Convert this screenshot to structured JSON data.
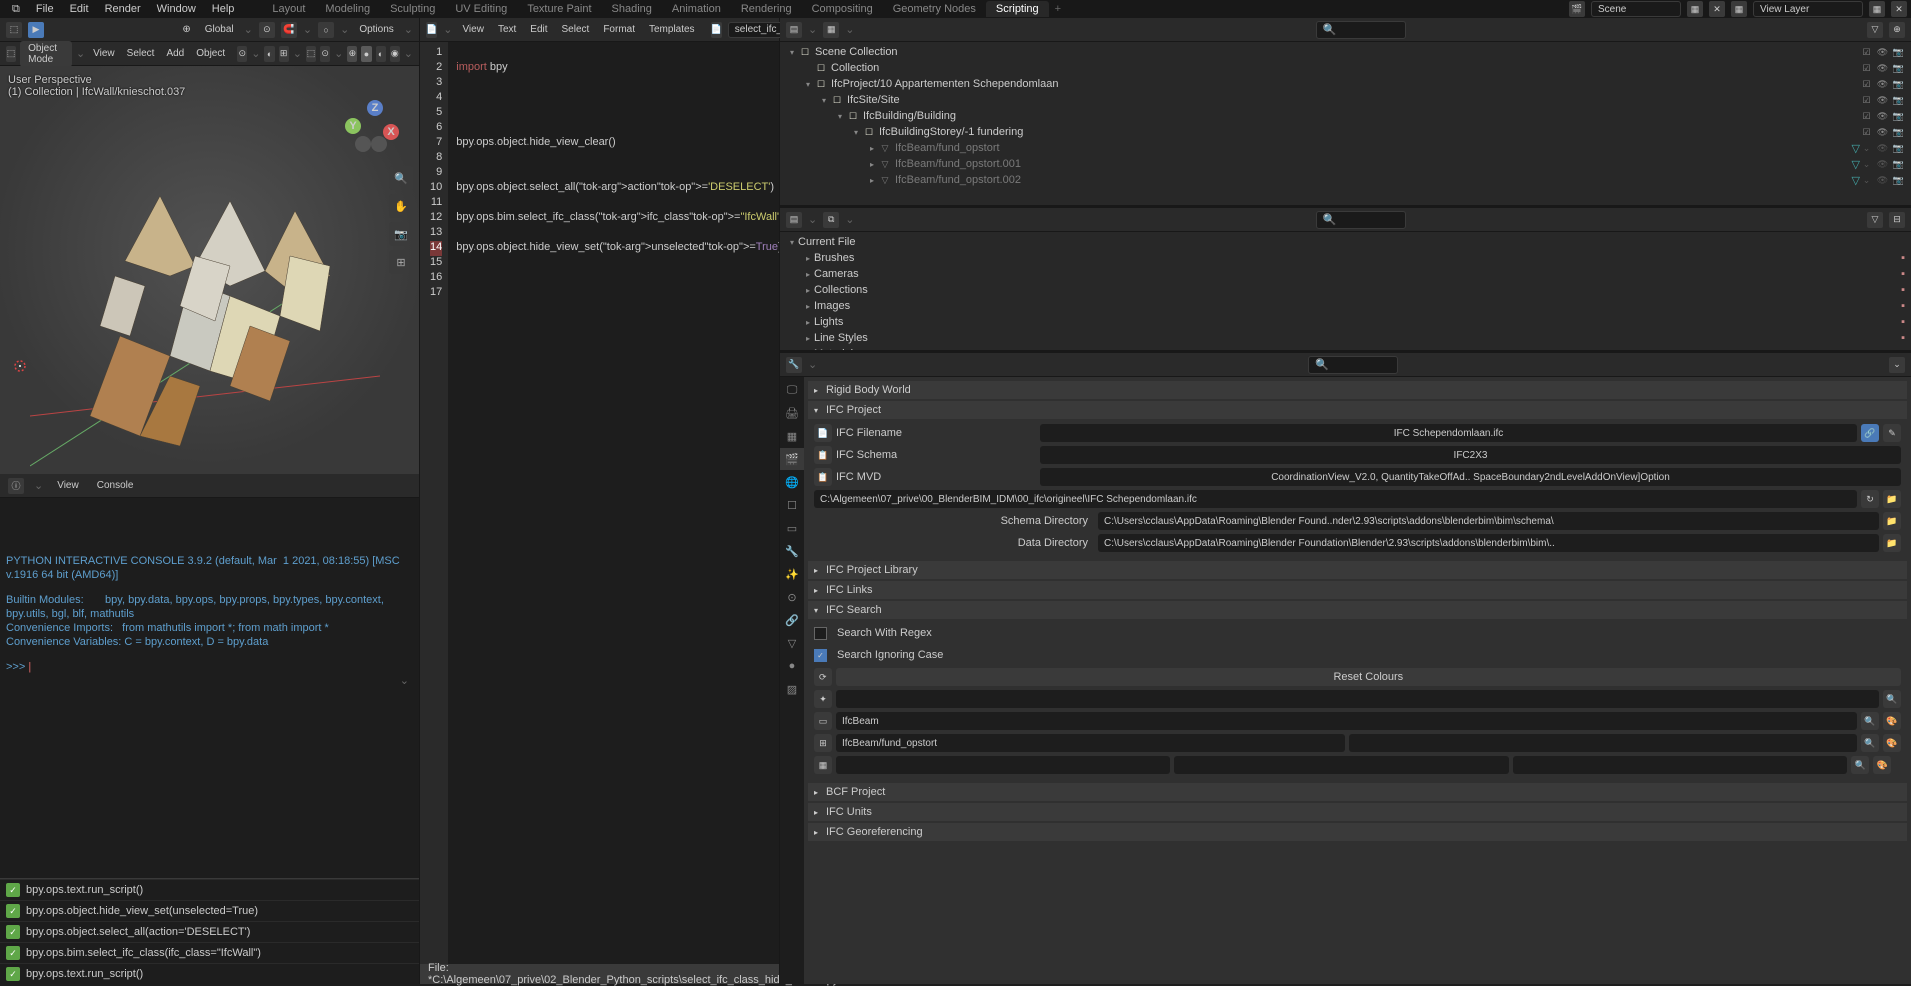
{
  "menu": {
    "logo": "⧉",
    "items": [
      "File",
      "Edit",
      "Render",
      "Window",
      "Help"
    ]
  },
  "workspaces": [
    "Layout",
    "Modeling",
    "Sculpting",
    "UV Editing",
    "Texture Paint",
    "Shading",
    "Animation",
    "Rendering",
    "Compositing",
    "Geometry Nodes",
    "Scripting"
  ],
  "active_workspace": "Scripting",
  "scene_selector": {
    "scene": "Scene",
    "layer": "View Layer"
  },
  "viewport": {
    "mode": "Object Mode",
    "menus": [
      "View",
      "Select",
      "Add",
      "Object"
    ],
    "orient": "Global",
    "info_line1": "User Perspective",
    "info_line2": "(1) Collection | IfcWall/knieschot.037",
    "axes": {
      "x": "X",
      "y": "Y",
      "z": "Z"
    },
    "options": "Options"
  },
  "text_editor": {
    "menus": [
      "View",
      "Text",
      "Edit",
      "Select",
      "Format",
      "Templates"
    ],
    "filename": "select_ifc_clas",
    "lines": [
      {
        "n": 1,
        "raw": ""
      },
      {
        "n": 2,
        "raw": "import bpy",
        "k": "import",
        "rest": " bpy"
      },
      {
        "n": 3,
        "raw": ""
      },
      {
        "n": 4,
        "raw": ""
      },
      {
        "n": 5,
        "raw": ""
      },
      {
        "n": 6,
        "raw": ""
      },
      {
        "n": 7,
        "raw": "bpy.ops.object.hide_view_clear()"
      },
      {
        "n": 8,
        "raw": ""
      },
      {
        "n": 9,
        "raw": ""
      },
      {
        "n": 10,
        "raw": "bpy.ops.object.select_all(action='DESELECT')"
      },
      {
        "n": 11,
        "raw": ""
      },
      {
        "n": 12,
        "raw": "bpy.ops.bim.select_ifc_class(ifc_class=\"IfcWall\")"
      },
      {
        "n": 13,
        "raw": ""
      },
      {
        "n": 14,
        "raw": "bpy.ops.object.hide_view_set(unselected=True)"
      },
      {
        "n": 15,
        "raw": ""
      },
      {
        "n": 16,
        "raw": ""
      },
      {
        "n": 17,
        "raw": ""
      }
    ],
    "current_line": 14,
    "footer": "File: *C:\\Algemeen\\07_prive\\02_Blender_Python_scripts\\select_ifc_class_hide_isolate.py"
  },
  "info_panel": {
    "menus": [
      "View",
      "Console"
    ]
  },
  "console": {
    "header": "PYTHON INTERACTIVE CONSOLE 3.9.2 (default, Mar  1 2021, 08:18:55) [MSC v.1916 64 bit (AMD64)]",
    "builtin": "Builtin Modules:       bpy, bpy.data, bpy.ops, bpy.props, bpy.types, bpy.context, bpy.utils, bgl, blf, mathutils",
    "imports": "Convenience Imports:   from mathutils import *; from math import *",
    "vars": "Convenience Variables: C = bpy.context, D = bpy.data",
    "prompt": ">>> ",
    "cursor": "|"
  },
  "reports": [
    "bpy.ops.text.run_script()",
    "bpy.ops.object.hide_view_set(unselected=True)",
    "bpy.ops.object.select_all(action='DESELECT')",
    "bpy.ops.bim.select_ifc_class(ifc_class=\"IfcWall\")",
    "bpy.ops.text.run_script()"
  ],
  "outliner": {
    "root": "Scene Collection",
    "tree": [
      {
        "depth": 0,
        "tw": "▾",
        "ic": "☐",
        "txt": "Scene Collection",
        "dim": false,
        "ricons": true
      },
      {
        "depth": 1,
        "tw": "",
        "ic": "☐",
        "txt": "Collection",
        "dim": false,
        "ricons": true
      },
      {
        "depth": 1,
        "tw": "▾",
        "ic": "☐",
        "txt": "IfcProject/10 Appartementen Schependomlaan",
        "dim": false,
        "ricons": true
      },
      {
        "depth": 2,
        "tw": "▾",
        "ic": "☐",
        "txt": "IfcSite/Site",
        "dim": false,
        "ricons": true
      },
      {
        "depth": 3,
        "tw": "▾",
        "ic": "☐",
        "txt": "IfcBuilding/Building",
        "dim": false,
        "ricons": true
      },
      {
        "depth": 4,
        "tw": "▾",
        "ic": "☐",
        "txt": "IfcBuildingStorey/-1 fundering",
        "dim": false,
        "ricons": true
      },
      {
        "depth": 5,
        "tw": "▸",
        "ic": "▽",
        "txt": "IfcBeam/fund_opstort",
        "dim": true,
        "ricons": false,
        "extra": "▽"
      },
      {
        "depth": 5,
        "tw": "▸",
        "ic": "▽",
        "txt": "IfcBeam/fund_opstort.001",
        "dim": true,
        "ricons": false,
        "extra": "▽"
      },
      {
        "depth": 5,
        "tw": "▸",
        "ic": "▽",
        "txt": "IfcBeam/fund_opstort.002",
        "dim": true,
        "ricons": false,
        "extra": "▽"
      }
    ]
  },
  "file_browser": {
    "root": "Current File",
    "cats": [
      {
        "label": "Brushes"
      },
      {
        "label": "Cameras"
      },
      {
        "label": "Collections"
      },
      {
        "label": "Images"
      },
      {
        "label": "Lights"
      },
      {
        "label": "Line Styles"
      },
      {
        "label": "Materials"
      }
    ]
  },
  "props": {
    "panels_top": [
      "Rigid Body World"
    ],
    "ifc_project": {
      "title": "IFC Project",
      "filename_label": "IFC Filename",
      "filename": "IFC Schependomlaan.ifc",
      "schema_label": "IFC Schema",
      "schema": "IFC2X3",
      "mvd_label": "IFC MVD",
      "mvd": "CoordinationView_V2.0, QuantityTakeOffAd.. SpaceBoundary2ndLevelAddOnView]Option",
      "path": "C:\\Algemeen\\07_prive\\00_BlenderBIM_IDM\\00_ifc\\origineel\\IFC Schependomlaan.ifc",
      "schema_dir_label": "Schema Directory",
      "schema_dir": "C:\\Users\\cclaus\\AppData\\Roaming\\Blender Found..nder\\2.93\\scripts\\addons\\blenderbim\\bim\\schema\\",
      "data_dir_label": "Data Directory",
      "data_dir": "C:\\Users\\cclaus\\AppData\\Roaming\\Blender Foundation\\Blender\\2.93\\scripts\\addons\\blenderbim\\bim\\.."
    },
    "panels_mid": [
      "IFC Project Library",
      "IFC Links"
    ],
    "ifc_search": {
      "title": "IFC Search",
      "regex_label": "Search With Regex",
      "regex": false,
      "ignore_label": "Search Ignoring Case",
      "ignore": true,
      "reset_btn": "Reset Colours",
      "field1": "",
      "field2": "IfcBeam",
      "field3": "IfcBeam/fund_opstort",
      "field4": ""
    },
    "panels_bot": [
      "BCF Project",
      "IFC Units",
      "IFC Georeferencing"
    ]
  }
}
